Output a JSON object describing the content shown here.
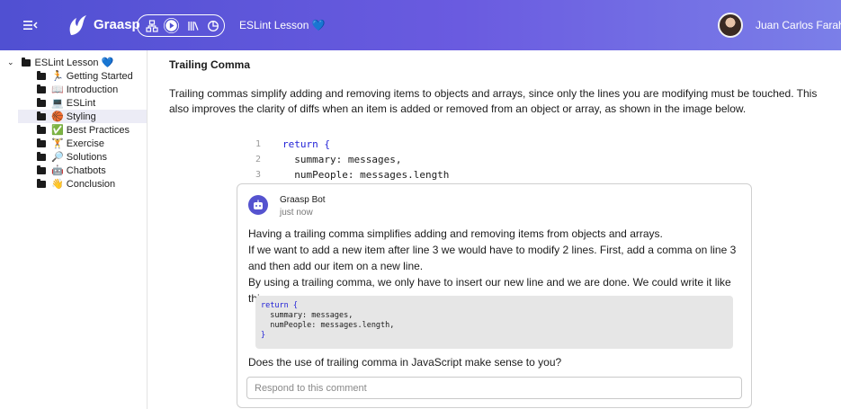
{
  "header": {
    "brand": "Graasp",
    "breadcrumb": "ESLint Lesson 💙",
    "user_name": "Juan Carlos Farah",
    "colors": {
      "gradient_start": "#5050d2",
      "gradient_end": "#7b7fe8"
    },
    "icons": [
      "menu-icon",
      "graasp-logo",
      "builder-mode-icon",
      "player-mode-icon",
      "library-icon",
      "analytics-icon"
    ]
  },
  "sidebar": {
    "root": {
      "label": "ESLint Lesson 💙",
      "expanded": true
    },
    "items": [
      {
        "label": "🏃 Getting Started",
        "selected": false
      },
      {
        "label": "📖 Introduction",
        "selected": false
      },
      {
        "label": "💻 ESLint",
        "selected": false
      },
      {
        "label": "🏀 Styling",
        "selected": true
      },
      {
        "label": "✅ Best Practices",
        "selected": false
      },
      {
        "label": "🏋 Exercise",
        "selected": false
      },
      {
        "label": "🔎 Solutions",
        "selected": false
      },
      {
        "label": "🤖 Chatbots",
        "selected": false
      },
      {
        "label": "👋 Conclusion",
        "selected": false
      }
    ]
  },
  "main": {
    "title": "Trailing Comma",
    "description": "Trailing commas simplify adding and removing items to objects and arrays, since only the lines you are modifying must be touched. This also improves the clarity of diffs when an item is added or removed from an object or array, as shown in the image below.",
    "code_lines": [
      {
        "num": "1",
        "text": "return {"
      },
      {
        "num": "2",
        "text": "  summary: messages,"
      },
      {
        "num": "3",
        "text": "  numPeople: messages.length"
      }
    ]
  },
  "comment": {
    "author": "Graasp Bot",
    "time": "just now",
    "paragraphs": [
      "Having a trailing comma simplifies adding and removing items from objects and arrays.",
      "If we want to add a new item after line 3 we would have to modify 2 lines. First, add a comma on line 3 and then add our item on a new line.",
      "By using a trailing comma, we only have to insert our new line and we are done. We could write it like this:"
    ],
    "code": [
      "return {",
      "  summary: messages,",
      "  numPeople: messages.length,",
      "}"
    ],
    "question": "Does the use of trailing comma in JavaScript make sense to you?",
    "respond_placeholder": "Respond to this comment"
  }
}
